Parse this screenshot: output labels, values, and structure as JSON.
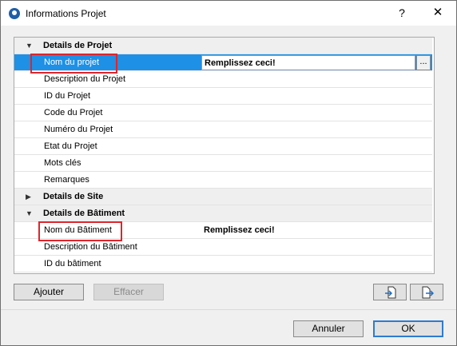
{
  "window": {
    "title": "Informations Projet",
    "help_label": "?",
    "close_label": "✕"
  },
  "tree": {
    "rows": [
      {
        "kind": "group",
        "expanded": true,
        "label": "Details de Projet",
        "toggle": "▼"
      },
      {
        "kind": "item",
        "label": "Nom du projet",
        "value": "Remplissez ceci!",
        "selected": true,
        "browse": "..."
      },
      {
        "kind": "item",
        "label": "Description du Projet",
        "value": ""
      },
      {
        "kind": "item",
        "label": "ID du Projet",
        "value": ""
      },
      {
        "kind": "item",
        "label": "Code du Projet",
        "value": ""
      },
      {
        "kind": "item",
        "label": "Numéro du Projet",
        "value": ""
      },
      {
        "kind": "item",
        "label": "Etat du Projet",
        "value": ""
      },
      {
        "kind": "item",
        "label": "Mots clés",
        "value": ""
      },
      {
        "kind": "item",
        "label": "Remarques",
        "value": ""
      },
      {
        "kind": "group",
        "expanded": false,
        "label": "Details de Site",
        "toggle": "▶"
      },
      {
        "kind": "group",
        "expanded": true,
        "label": "Details de Bâtiment",
        "toggle": "▼"
      },
      {
        "kind": "item",
        "label": "Nom du Bâtiment",
        "value": "Remplissez ceci!"
      },
      {
        "kind": "item",
        "label": "Description du Bâtiment",
        "value": ""
      },
      {
        "kind": "item",
        "label": "ID du bâtiment",
        "value": ""
      }
    ],
    "scroll_up": "▲",
    "scroll_down": "▼"
  },
  "buttons": {
    "add": "Ajouter",
    "delete": "Effacer",
    "import_icon": "import-file-icon",
    "export_icon": "export-file-icon",
    "cancel": "Annuler",
    "ok": "OK"
  },
  "colors": {
    "selection": "#1e90e6",
    "highlight": "#e0242b"
  }
}
